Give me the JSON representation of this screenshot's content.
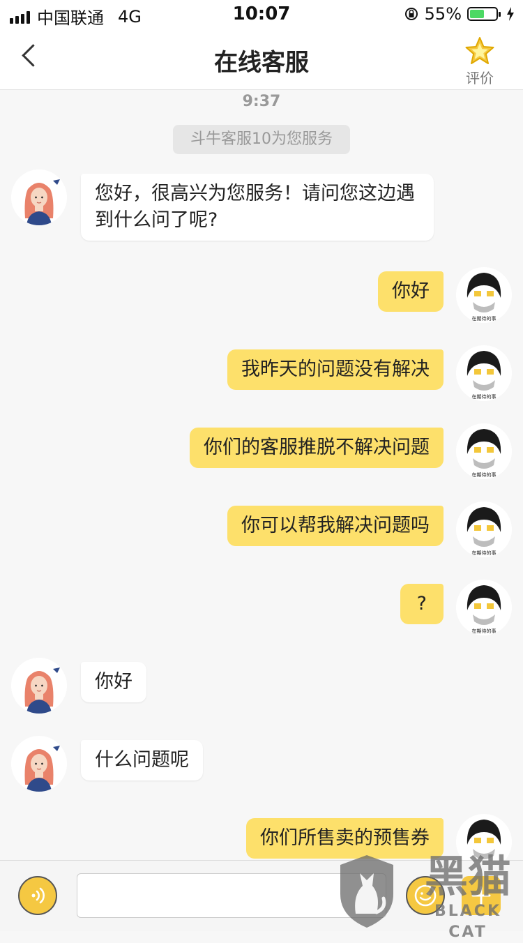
{
  "status_bar": {
    "carrier": "中国联通",
    "network": "4G",
    "time": "10:07",
    "battery_percent": "55%",
    "battery_level": 0.55,
    "icons": [
      "signal-bars-icon",
      "rotation-lock-icon",
      "battery-icon",
      "charging-bolt-icon"
    ]
  },
  "nav": {
    "title": "在线客服",
    "rate_label": "评价",
    "back_icon": "chevron-left-icon",
    "rate_icon": "star-icon"
  },
  "chat": {
    "timestamp": "9:37",
    "system_notice": "斗牛客服10为您服务",
    "messages": [
      {
        "side": "left",
        "text": "您好，很高兴为您服务！请问您这边遇到什么问了呢?"
      },
      {
        "side": "right",
        "text": "你好"
      },
      {
        "side": "right",
        "text": "我昨天的问题没有解决"
      },
      {
        "side": "right",
        "text": "你们的客服推脱不解决问题"
      },
      {
        "side": "right",
        "text": "你可以帮我解决问题吗"
      },
      {
        "side": "right",
        "text": "?"
      },
      {
        "side": "left",
        "text": "你好"
      },
      {
        "side": "left",
        "text": "什么问题呢"
      },
      {
        "side": "right",
        "text": "你们所售卖的预售券"
      }
    ],
    "user_avatar_caption": "在期待的事"
  },
  "input_bar": {
    "placeholder": "",
    "voice_icon": "voice-icon",
    "emoji_icon": "emoji-icon",
    "plus_icon": "plus-icon"
  },
  "watermark": {
    "text_zh": "黑猫",
    "text_en": "BLACK CAT"
  },
  "colors": {
    "accent": "#f5c842",
    "user_bubble": "#fde06b",
    "agent_bubble": "#ffffff",
    "background": "#f7f7f7"
  }
}
